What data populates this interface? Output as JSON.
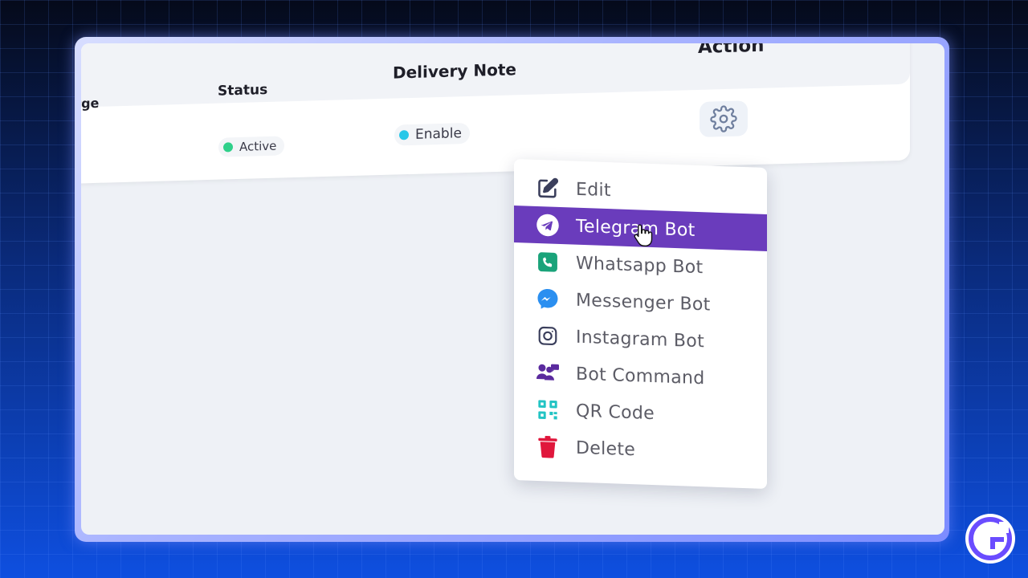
{
  "table": {
    "headers": {
      "charge": "narge",
      "status": "Status",
      "delivery_note": "Delivery Note",
      "action": "Action"
    },
    "row": {
      "status": {
        "label": "Active",
        "color": "#2fd08a"
      },
      "delivery_note": {
        "label": "Enable",
        "color": "#27c7e8"
      },
      "action_icon": "gear-icon"
    }
  },
  "menu": {
    "items": [
      {
        "label": "Edit",
        "icon": "edit-icon",
        "color": "#3b3f5c"
      },
      {
        "label": "Telegram Bot",
        "icon": "telegram-icon",
        "color": "#ffffff",
        "selected": true
      },
      {
        "label": "Whatsapp Bot",
        "icon": "whatsapp-icon",
        "color": "#1aa37a"
      },
      {
        "label": "Messenger Bot",
        "icon": "messenger-icon",
        "color": "#2b8ff0"
      },
      {
        "label": "Instagram Bot",
        "icon": "instagram-icon",
        "color": "#3b3f5c"
      },
      {
        "label": "Bot Command",
        "icon": "bot-command-icon",
        "color": "#5a2a9e"
      },
      {
        "label": "QR Code",
        "icon": "qr-code-icon",
        "color": "#22c4c4"
      },
      {
        "label": "Delete",
        "icon": "trash-icon",
        "color": "#e0173c"
      }
    ],
    "highlight_color": "#6a3cbc"
  },
  "brand": {
    "logo": "g-logo-icon",
    "color": "#6a4cff"
  }
}
